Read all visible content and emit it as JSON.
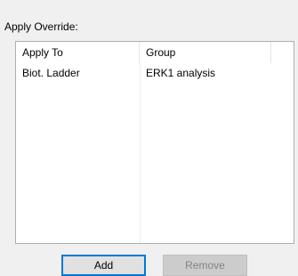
{
  "override_panel": {
    "label": "Apply Override:",
    "columns": [
      "Apply To",
      "Group"
    ],
    "rows": [
      {
        "apply_to": "Biot. Ladder",
        "group": "ERK1 analysis"
      }
    ]
  },
  "buttons": {
    "add_label": "Add",
    "remove_label": "Remove",
    "remove_enabled": false
  },
  "colors": {
    "window_bg": "#f0f0f0",
    "focus_border": "#0078d7",
    "disabled_text": "#838383"
  }
}
